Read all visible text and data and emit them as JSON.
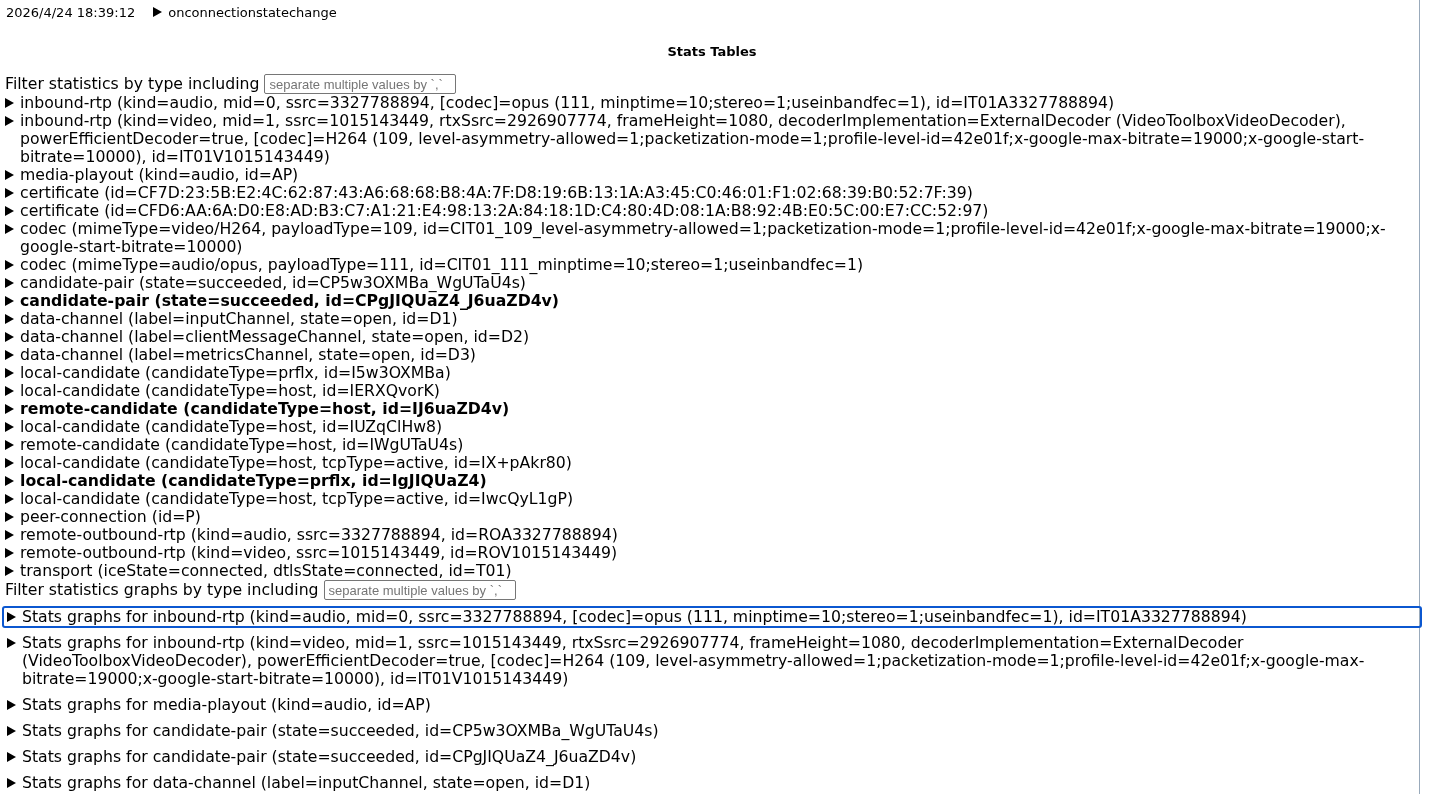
{
  "event_log": {
    "timestamp": "2026/4/24 18:39:12",
    "event": {
      "label": "onconnectionstatechange",
      "expanded": false
    }
  },
  "stats_tables": {
    "title": "Stats Tables",
    "filter": {
      "label": "Filter statistics by type including",
      "placeholder": "separate multiple values by `,`"
    },
    "entries": [
      {
        "text": "inbound-rtp (kind=audio, mid=0, ssrc=3327788894, [codec]=opus (111, minptime=10;stereo=1;useinbandfec=1), id=IT01A3327788894)",
        "bold": false,
        "expanded": false
      },
      {
        "text": "inbound-rtp (kind=video, mid=1, ssrc=1015143449, rtxSsrc=2926907774, frameHeight=1080, decoderImplementation=ExternalDecoder (VideoToolboxVideoDecoder), powerEfficientDecoder=true, [codec]=H264 (109, level-asymmetry-allowed=1;packetization-mode=1;profile-level-id=42e01f;x-google-max-bitrate=19000;x-google-start-bitrate=10000), id=IT01V1015143449)",
        "bold": false,
        "expanded": false
      },
      {
        "text": "media-playout (kind=audio, id=AP)",
        "bold": false,
        "expanded": false
      },
      {
        "text": "certificate (id=CF7D:23:5B:E2:4C:62:87:43:A6:68:68:B8:4A:7F:D8:19:6B:13:1A:A3:45:C0:46:01:F1:02:68:39:B0:52:7F:39)",
        "bold": false,
        "expanded": false
      },
      {
        "text": "certificate (id=CFD6:AA:6A:D0:E8:AD:B3:C7:A1:21:E4:98:13:2A:84:18:1D:C4:80:4D:08:1A:B8:92:4B:E0:5C:00:E7:CC:52:97)",
        "bold": false,
        "expanded": false
      },
      {
        "text": "codec (mimeType=video/H264, payloadType=109, id=CIT01_109_level-asymmetry-allowed=1;packetization-mode=1;profile-level-id=42e01f;x-google-max-bitrate=19000;x-google-start-bitrate=10000)",
        "bold": false,
        "expanded": false
      },
      {
        "text": "codec (mimeType=audio/opus, payloadType=111, id=CIT01_111_minptime=10;stereo=1;useinbandfec=1)",
        "bold": false,
        "expanded": false
      },
      {
        "text": "candidate-pair (state=succeeded, id=CP5w3OXMBa_WgUTaU4s)",
        "bold": false,
        "expanded": false
      },
      {
        "text": "candidate-pair (state=succeeded, id=CPgJIQUaZ4_J6uaZD4v)",
        "bold": true,
        "expanded": false
      },
      {
        "text": "data-channel (label=inputChannel, state=open, id=D1)",
        "bold": false,
        "expanded": false
      },
      {
        "text": "data-channel (label=clientMessageChannel, state=open, id=D2)",
        "bold": false,
        "expanded": false
      },
      {
        "text": "data-channel (label=metricsChannel, state=open, id=D3)",
        "bold": false,
        "expanded": false
      },
      {
        "text": "local-candidate (candidateType=prflx, id=I5w3OXMBa)",
        "bold": false,
        "expanded": false
      },
      {
        "text": "local-candidate (candidateType=host, id=IERXQvorK)",
        "bold": false,
        "expanded": false
      },
      {
        "text": "remote-candidate (candidateType=host, id=IJ6uaZD4v)",
        "bold": true,
        "expanded": false
      },
      {
        "text": "local-candidate (candidateType=host, id=IUZqClHw8)",
        "bold": false,
        "expanded": false
      },
      {
        "text": "remote-candidate (candidateType=host, id=IWgUTaU4s)",
        "bold": false,
        "expanded": false
      },
      {
        "text": "local-candidate (candidateType=host, tcpType=active, id=IX+pAkr80)",
        "bold": false,
        "expanded": false
      },
      {
        "text": "local-candidate (candidateType=prflx, id=IgJIQUaZ4)",
        "bold": true,
        "expanded": false
      },
      {
        "text": "local-candidate (candidateType=host, tcpType=active, id=IwcQyL1gP)",
        "bold": false,
        "expanded": false
      },
      {
        "text": "peer-connection (id=P)",
        "bold": false,
        "expanded": false
      },
      {
        "text": "remote-outbound-rtp (kind=audio, ssrc=3327788894, id=ROA3327788894)",
        "bold": false,
        "expanded": false
      },
      {
        "text": "remote-outbound-rtp (kind=video, ssrc=1015143449, id=ROV1015143449)",
        "bold": false,
        "expanded": false
      },
      {
        "text": "transport (iceState=connected, dtlsState=connected, id=T01)",
        "bold": false,
        "expanded": false
      }
    ]
  },
  "stats_graphs": {
    "filter": {
      "label": "Filter statistics graphs by type including",
      "placeholder": "separate multiple values by `,`"
    },
    "entries": [
      {
        "text": "Stats graphs for inbound-rtp (kind=audio, mid=0, ssrc=3327788894, [codec]=opus (111, minptime=10;stereo=1;useinbandfec=1), id=IT01A3327788894)",
        "focused": true,
        "expanded": false
      },
      {
        "text": "Stats graphs for inbound-rtp (kind=video, mid=1, ssrc=1015143449, rtxSsrc=2926907774, frameHeight=1080, decoderImplementation=ExternalDecoder (VideoToolboxVideoDecoder), powerEfficientDecoder=true, [codec]=H264 (109, level-asymmetry-allowed=1;packetization-mode=1;profile-level-id=42e01f;x-google-max-bitrate=19000;x-google-start-bitrate=10000), id=IT01V1015143449)",
        "focused": false,
        "expanded": false
      },
      {
        "text": "Stats graphs for media-playout (kind=audio, id=AP)",
        "focused": false,
        "expanded": false
      },
      {
        "text": "Stats graphs for candidate-pair (state=succeeded, id=CP5w3OXMBa_WgUTaU4s)",
        "focused": false,
        "expanded": false
      },
      {
        "text": "Stats graphs for candidate-pair (state=succeeded, id=CPgJIQUaZ4_J6uaZD4v)",
        "focused": false,
        "expanded": false
      },
      {
        "text": "Stats graphs for data-channel (label=inputChannel, state=open, id=D1)",
        "focused": false,
        "expanded": false
      }
    ]
  }
}
